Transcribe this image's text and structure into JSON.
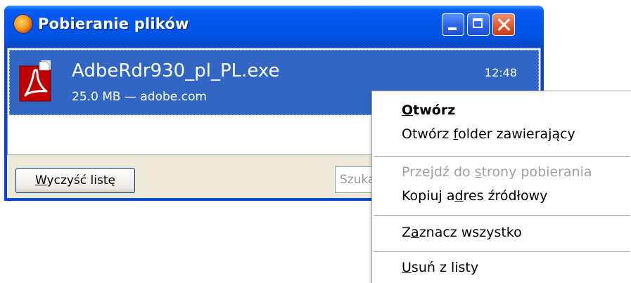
{
  "window": {
    "title": "Pobieranie plików"
  },
  "download": {
    "file_name": "AdbeRdr930_pl_PL.exe",
    "meta": "25.0 MB — adobe.com",
    "time": "12:48"
  },
  "bottom": {
    "clear_button": {
      "prefix": "",
      "accel": "W",
      "rest": "yczyść listę"
    },
    "search_placeholder": "Szukaj"
  },
  "context_menu": {
    "open": {
      "prefix": "",
      "accel": "O",
      "rest": "twórz"
    },
    "open_folder": {
      "prefix": "Otwórz ",
      "accel": "f",
      "rest": "older zawierający"
    },
    "go_to_page": {
      "prefix": "Przejdź do ",
      "accel": "s",
      "rest": "trony pobierania"
    },
    "copy_address": {
      "prefix": "Kopiuj a",
      "accel": "d",
      "rest": "res źródłowy"
    },
    "select_all": {
      "prefix": "Z",
      "accel": "a",
      "rest": "znacz wszystko"
    },
    "remove_from_list": {
      "prefix": "",
      "accel": "U",
      "rest": "suń z listy"
    }
  },
  "colors": {
    "titlebar": "#0055ea",
    "selection": "#3166c5",
    "window_bg": "#ece9d8",
    "close_button": "#e2582f"
  },
  "icons": {
    "app": "firefox-icon",
    "file": "adobe-reader-pdf-icon"
  }
}
